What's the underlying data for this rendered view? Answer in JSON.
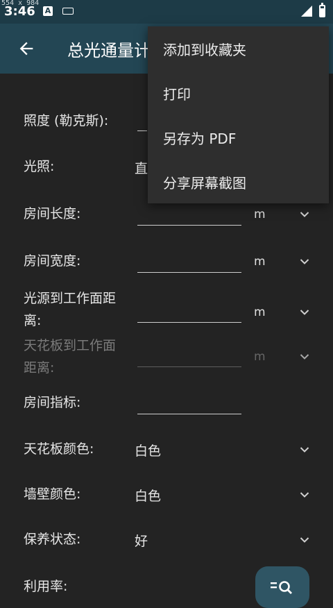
{
  "status_bar": {
    "dimension_note": "554 x 984",
    "time": "3:46",
    "notification_badge": "A"
  },
  "app_bar": {
    "title": "总光通量计"
  },
  "form": {
    "illuminance_label": "照度 (勒克斯):",
    "lighting_label": "光照:",
    "lighting_value": "直",
    "room_length_label": "房间长度:",
    "room_length_unit": "m",
    "room_width_label": "房间宽度:",
    "room_width_unit": "m",
    "source_distance_label_1": "光源到工作面距",
    "source_distance_label_2": "离:",
    "source_distance_unit": "m",
    "ceiling_distance_label_1": "天花板到工作面",
    "ceiling_distance_label_2": "距离:",
    "ceiling_distance_unit": "m",
    "room_index_label": "房间指标:",
    "ceiling_color_label": "天花板颜色:",
    "ceiling_color_value": "白色",
    "wall_color_label": "墙壁颜色:",
    "wall_color_value": "白色",
    "maintenance_label": "保养状态:",
    "maintenance_value": "好",
    "utilization_label": "利用率:"
  },
  "menu": {
    "items": [
      {
        "label": "添加到收藏夹"
      },
      {
        "label": "打印"
      },
      {
        "label": "另存为 PDF"
      },
      {
        "label": "分享屏幕截图"
      }
    ]
  },
  "icons": [
    "back-arrow-icon",
    "chevron-down-icon",
    "list-search-icon"
  ],
  "colors": {
    "app_bar": "#234654",
    "status_bar": "#1d3b47",
    "background": "#232323",
    "menu": "#2e2e2e",
    "fab": "#2f5564"
  }
}
